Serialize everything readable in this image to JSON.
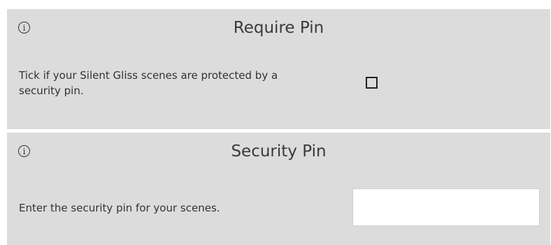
{
  "require_pin": {
    "title": "Require Pin",
    "description": "Tick if your Silent Gliss scenes are protected by a security pin.",
    "checked": false,
    "info_icon": "info-icon"
  },
  "security_pin": {
    "title": "Security Pin",
    "description": "Enter the security pin for your scenes.",
    "value": "",
    "info_icon": "info-icon"
  }
}
